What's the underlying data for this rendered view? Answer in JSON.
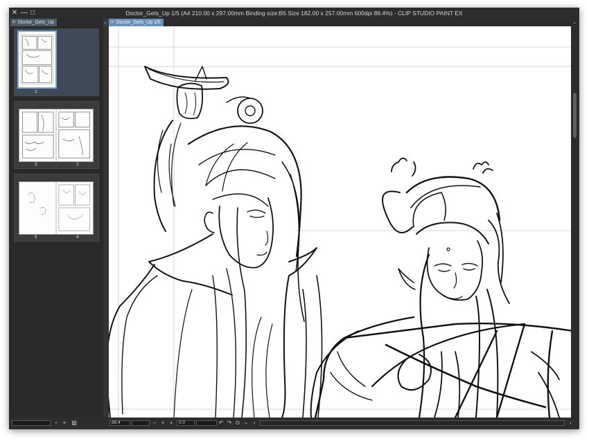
{
  "window": {
    "title": "Doctor_Gets_Up 1/5 (A4 210.00 x 297.00mm Binding size:B5 Size 182.00 x 257.00mm 600dpi 88.4%)  - CLIP STUDIO PAINT EX",
    "close_icon": "✕",
    "minimize_icon": "—",
    "maximize_icon": "□"
  },
  "left_tab": {
    "close_icon": "✕",
    "label": "Doctor_Gets_Up",
    "menu_icon": "⌄"
  },
  "canvas_tab": {
    "close_icon": "✕",
    "label": "Doctor_Gets_Up 1/5",
    "menu_icon": "⌄"
  },
  "pages": [
    {
      "labels": [
        "1"
      ]
    },
    {
      "labels": [
        "3",
        "2"
      ]
    },
    {
      "labels": [
        "5",
        "4"
      ]
    }
  ],
  "status": {
    "left_zoom_out": "−",
    "left_zoom_in": "+",
    "layout_icon": "▧",
    "zoom_value": "88.4",
    "zoom_out": "−",
    "zoom_in": "+",
    "fit": "▪",
    "rotation_value": "0.0",
    "rotate_left": "↶",
    "rotate_right": "↷",
    "rotate_reset": "⊙",
    "flip": "⇔",
    "scroll_left": "‹",
    "scroll_right": "›"
  },
  "colors": {
    "titlebar": "#2d2d2d",
    "panel": "#2a2a2a",
    "active_tab": "#6a8fb8",
    "selection": "#7ea6d6"
  }
}
